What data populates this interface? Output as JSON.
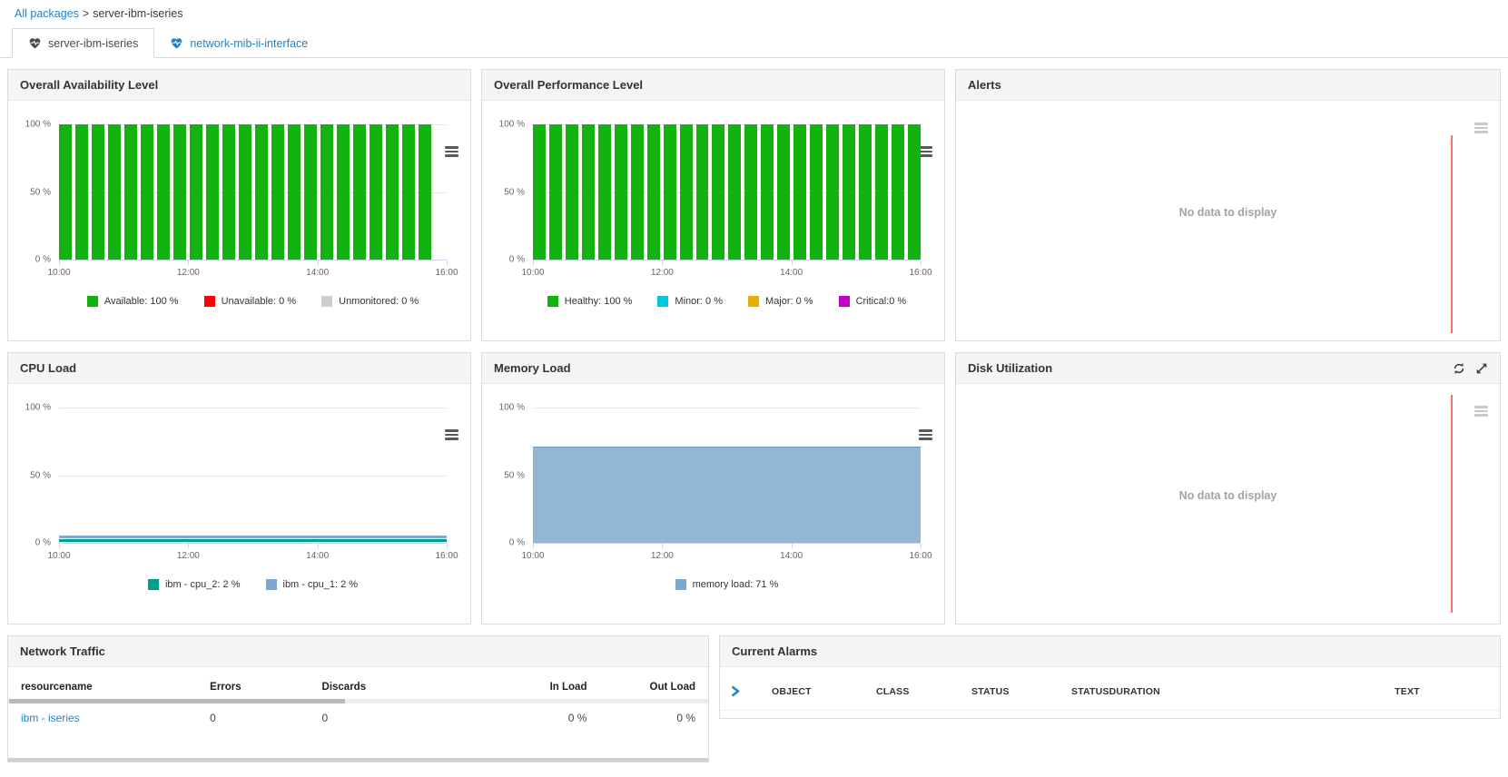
{
  "breadcrumb": {
    "link": "All packages",
    "separator": ">",
    "current": "server-ibm-iseries"
  },
  "tabs": [
    {
      "label": "server-ibm-iseries",
      "active": true
    },
    {
      "label": "network-mib-ii-interface",
      "active": false
    }
  ],
  "empty_text": "No data to display",
  "colors": {
    "green": "#12b30f",
    "red": "#ff0000",
    "unmonitored_gray": "#cdcdcd",
    "cyan": "#00c8dc",
    "gold": "#e5ae00",
    "magenta": "#c400c4",
    "teal": "#00a287",
    "steel_blue": "#7ba8ce",
    "area_fill": "#92b6d4",
    "link_blue": "#2583c5",
    "empty_redline": "#f4736e"
  },
  "panels": {
    "availability": {
      "title": "Overall Availability Level"
    },
    "performance": {
      "title": "Overall Performance Level"
    },
    "alerts": {
      "title": "Alerts"
    },
    "cpu": {
      "title": "CPU Load"
    },
    "memory": {
      "title": "Memory Load"
    },
    "disk": {
      "title": "Disk Utilization"
    },
    "network_traffic": {
      "title": "Network Traffic",
      "columns": [
        "resourcename",
        "Errors",
        "Discards",
        "In Load",
        "Out Load"
      ],
      "rows": [
        [
          "ibm - iseries",
          "0",
          "0",
          "0 %",
          "0 %"
        ]
      ]
    },
    "current_alarms": {
      "title": "Current Alarms",
      "columns": [
        "OBJECT",
        "CLASS",
        "STATUS",
        "STATUSDURATION",
        "TEXT"
      ],
      "rows": []
    }
  },
  "chart_data": [
    {
      "key": "availability",
      "type": "bar",
      "title": "Overall Availability Level",
      "x": [
        "10:00",
        "12:00",
        "14:00",
        "16:00"
      ],
      "y_ticks": [
        "100 %",
        "50 %",
        "0 %"
      ],
      "ylim": [
        0,
        100
      ],
      "bar_color": "#12b30f",
      "values": [
        100,
        100,
        100,
        100,
        100,
        100,
        100,
        100,
        100,
        100,
        100,
        100,
        100,
        100,
        100,
        100,
        100,
        100,
        100,
        100,
        100,
        100,
        100
      ],
      "legend": [
        {
          "label": "Available: 100 %",
          "color": "#12b30f"
        },
        {
          "label": "Unavailable: 0 %",
          "color": "#ff0000"
        },
        {
          "label": "Unmonitored: 0 %",
          "color": "#cdcdcd"
        }
      ]
    },
    {
      "key": "performance",
      "type": "bar",
      "title": "Overall Performance Level",
      "x": [
        "10:00",
        "12:00",
        "14:00",
        "16:00"
      ],
      "y_ticks": [
        "100 %",
        "50 %",
        "0 %"
      ],
      "ylim": [
        0,
        100
      ],
      "bar_color": "#12b30f",
      "values": [
        100,
        100,
        100,
        100,
        100,
        100,
        100,
        100,
        100,
        100,
        100,
        100,
        100,
        100,
        100,
        100,
        100,
        100,
        100,
        100,
        100,
        100,
        100,
        100
      ],
      "legend": [
        {
          "label": "Healthy: 100 %",
          "color": "#12b30f"
        },
        {
          "label": "Minor: 0 %",
          "color": "#00c8dc"
        },
        {
          "label": "Major: 0 %",
          "color": "#e5ae00"
        },
        {
          "label": "Critical:0 %",
          "color": "#c400c4"
        }
      ]
    },
    {
      "key": "cpu",
      "type": "line",
      "title": "CPU Load",
      "x": [
        "10:00",
        "12:00",
        "14:00",
        "16:00"
      ],
      "y_ticks": [
        "100 %",
        "50 %",
        "0 %"
      ],
      "ylim": [
        0,
        100
      ],
      "series": [
        {
          "name": "ibm - cpu_2",
          "value": 2,
          "color": "#00a287",
          "label": "ibm - cpu_2: 2 %"
        },
        {
          "name": "ibm - cpu_1",
          "value": 2,
          "color": "#7ba8ce",
          "label": "ibm - cpu_1: 2 %"
        }
      ]
    },
    {
      "key": "memory",
      "type": "area",
      "title": "Memory Load",
      "x": [
        "10:00",
        "12:00",
        "14:00",
        "16:00"
      ],
      "y_ticks": [
        "100 %",
        "50 %",
        "0 %"
      ],
      "ylim": [
        0,
        100
      ],
      "series": [
        {
          "name": "memory load",
          "value": 71,
          "color": "#92b6d4",
          "line_color": "#6d9ac0",
          "legend_color": "#7ba8ce",
          "label": "memory load: 71 %"
        }
      ]
    }
  ]
}
